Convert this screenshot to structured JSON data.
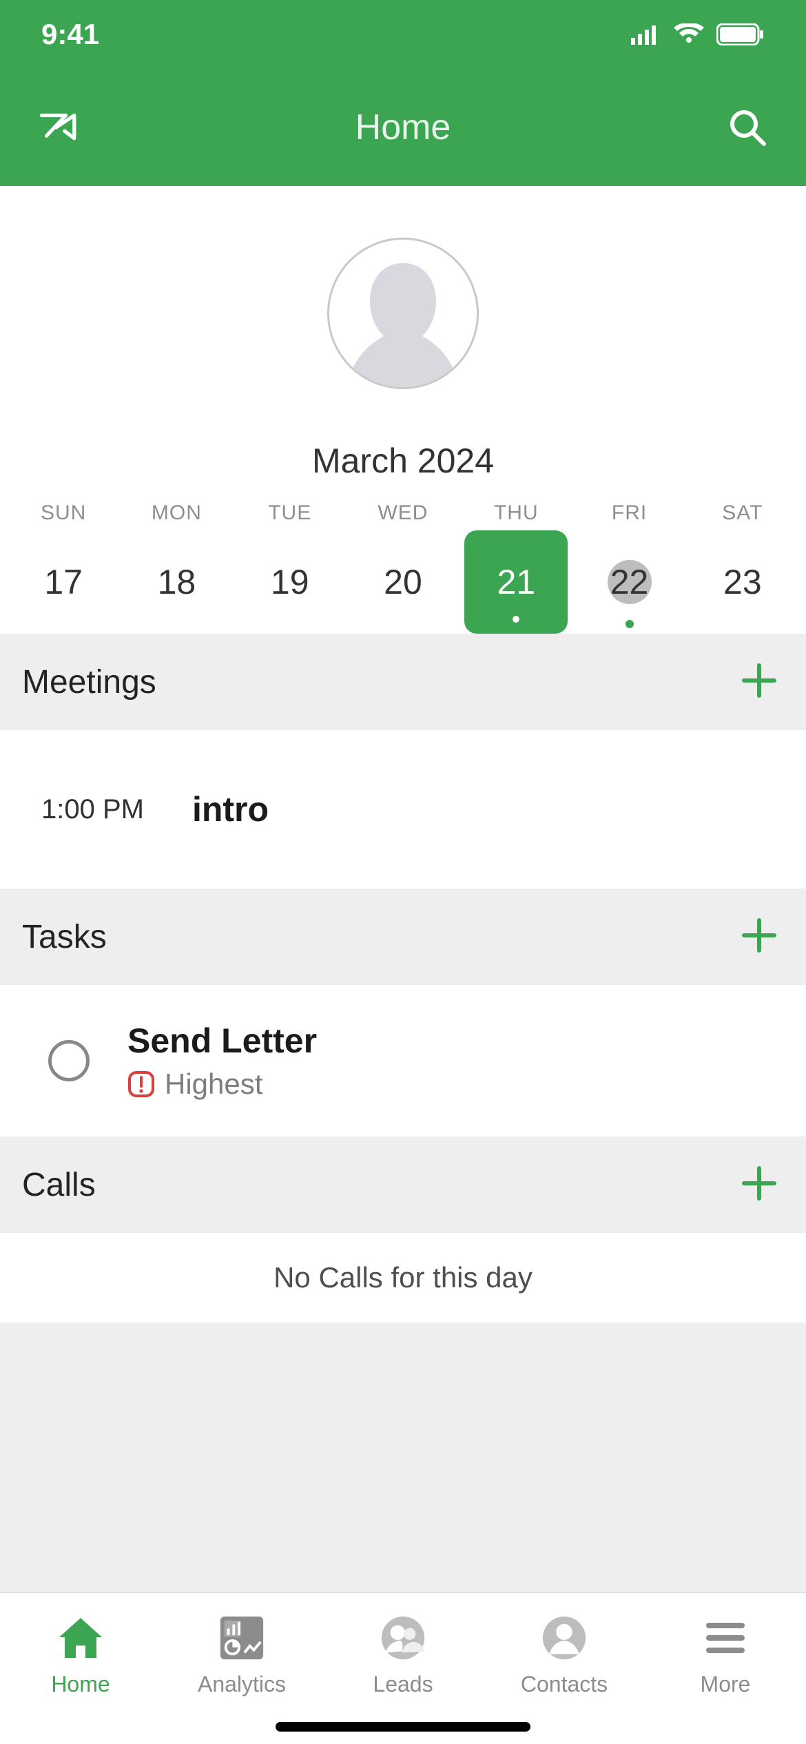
{
  "status": {
    "time": "9:41"
  },
  "header": {
    "title": "Home"
  },
  "calendar": {
    "month_label": "March 2024",
    "day_names": [
      "SUN",
      "MON",
      "TUE",
      "WED",
      "THU",
      "FRI",
      "SAT"
    ],
    "days": [
      "17",
      "18",
      "19",
      "20",
      "21",
      "22",
      "23"
    ],
    "selected_index": 4,
    "today_index": 5,
    "dot_indices": [
      5
    ]
  },
  "sections": {
    "meetings": {
      "title": "Meetings"
    },
    "tasks": {
      "title": "Tasks"
    },
    "calls": {
      "title": "Calls",
      "empty_text": "No Calls for this day"
    }
  },
  "meetings": [
    {
      "time": "1:00 PM",
      "title": "intro"
    }
  ],
  "tasks": [
    {
      "title": "Send Letter",
      "priority": "Highest"
    }
  ],
  "tabs": [
    {
      "label": "Home",
      "icon": "home-icon",
      "active": true
    },
    {
      "label": "Analytics",
      "icon": "analytics-icon",
      "active": false
    },
    {
      "label": "Leads",
      "icon": "leads-icon",
      "active": false
    },
    {
      "label": "Contacts",
      "icon": "contacts-icon",
      "active": false
    },
    {
      "label": "More",
      "icon": "more-icon",
      "active": false
    }
  ],
  "colors": {
    "brand": "#3ca552",
    "inactive": "#8c8c8c"
  }
}
